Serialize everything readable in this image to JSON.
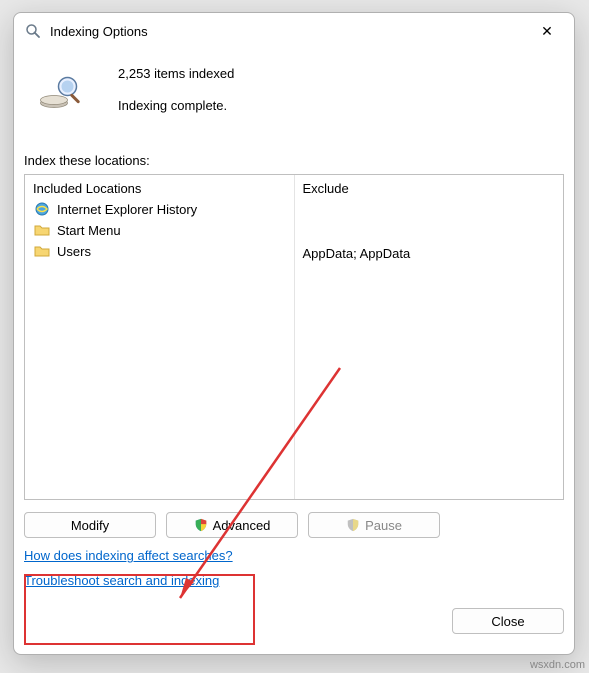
{
  "dialog": {
    "title": "Indexing Options",
    "count_line": "2,253 items indexed",
    "status_line": "Indexing complete.",
    "section_label": "Index these locations:"
  },
  "columns": {
    "left_header": "Included Locations",
    "right_header": "Exclude"
  },
  "locations": {
    "item0": {
      "label": "Internet Explorer History",
      "exclude": ""
    },
    "item1": {
      "label": "Start Menu",
      "exclude": ""
    },
    "item2": {
      "label": "Users",
      "exclude": "AppData; AppData"
    }
  },
  "buttons": {
    "modify": "Modify",
    "advanced": "Advanced",
    "pause": "Pause",
    "close": "Close"
  },
  "links": {
    "how": "How does indexing affect searches?",
    "troubleshoot": "Troubleshoot search and indexing"
  },
  "watermark": "wsxdn.com",
  "colors": {
    "link": "#0066cc",
    "highlight": "#d33"
  }
}
